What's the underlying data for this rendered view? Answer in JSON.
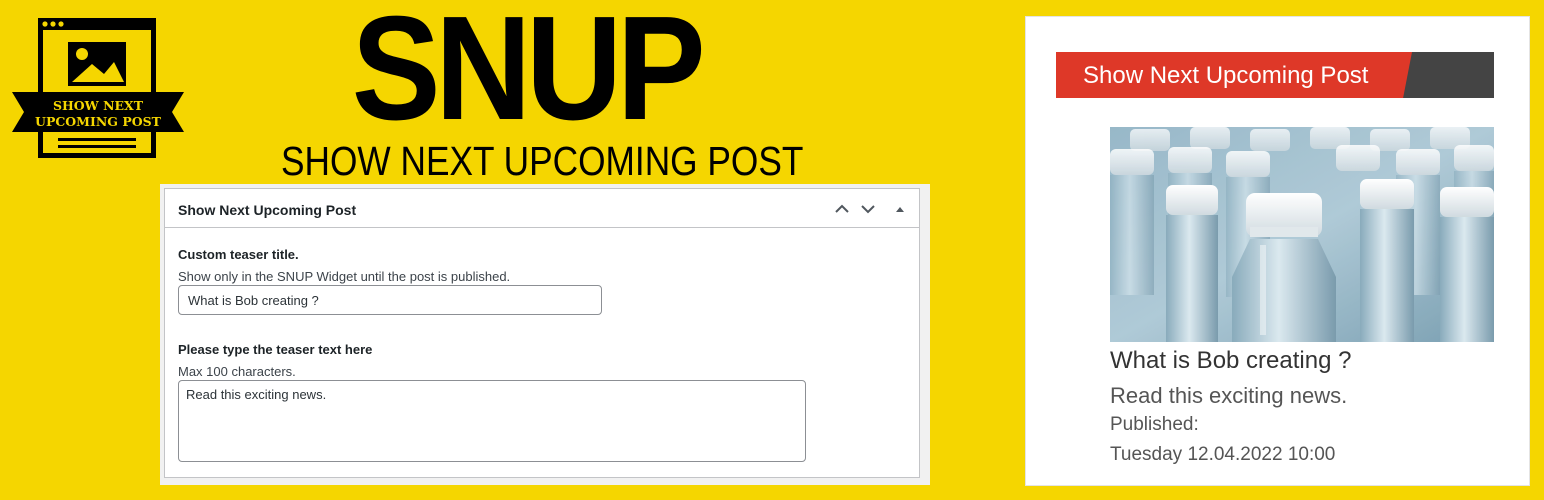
{
  "logo": {
    "line1": "SHOW NEXT",
    "line2": "UPCOMING POST",
    "icon": "image-window-icon"
  },
  "hero": {
    "title": "SNUP",
    "subtitle": "SHOW NEXT UPCOMING POST"
  },
  "metabox": {
    "title": "Show Next Upcoming Post",
    "controls": [
      "chevron-up-icon",
      "chevron-down-icon",
      "caret-up-icon"
    ],
    "field1": {
      "label": "Custom teaser title.",
      "description": "Show only in the SNUP Widget until the post is published.",
      "value": "What is Bob creating ?"
    },
    "field2": {
      "label": "Please type the teaser text here",
      "description": "Max 100 characters.",
      "value": "Read this exciting news."
    }
  },
  "widget": {
    "header": "Show Next Upcoming Post",
    "post_title": "What is Bob creating ?",
    "teaser": "Read this exciting news.",
    "published_label": "Published:",
    "published_date": "Tuesday 12.04.2022 10:00"
  },
  "colors": {
    "background": "#f5d600",
    "header_red": "#de3828",
    "header_dark": "#444444"
  }
}
